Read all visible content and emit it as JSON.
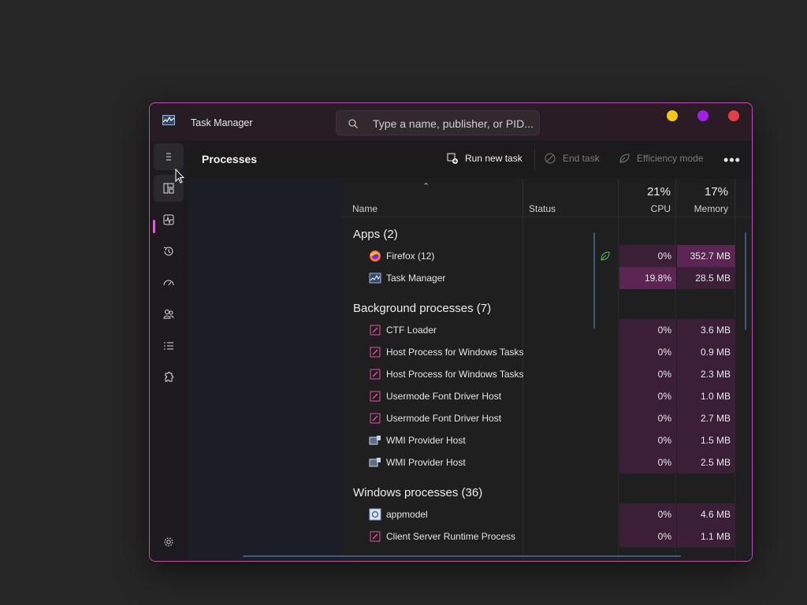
{
  "window": {
    "title": "Task Manager"
  },
  "search": {
    "placeholder": "Type a name, publisher, or PID..."
  },
  "toolbar": {
    "page_title": "Processes",
    "run_new_task": "Run new task",
    "end_task": "End task",
    "efficiency_mode": "Efficiency mode",
    "more": "•••"
  },
  "columns": {
    "name": "Name",
    "status": "Status",
    "cpu_pct": "21%",
    "cpu": "CPU",
    "memory_pct": "17%",
    "memory": "Memory"
  },
  "groups": {
    "apps": "Apps (2)",
    "background": "Background processes (7)",
    "windows": "Windows processes (36)"
  },
  "apps": [
    {
      "name": "Firefox (12)",
      "icon": "firefox-icon",
      "cpu": "0%",
      "memory": "352.7 MB",
      "efficiency": true
    },
    {
      "name": "Task Manager",
      "icon": "task-manager-icon",
      "cpu": "19.8%",
      "memory": "28.5 MB"
    }
  ],
  "background": [
    {
      "name": "CTF Loader",
      "icon": "edit-icon",
      "cpu": "0%",
      "memory": "3.6 MB"
    },
    {
      "name": "Host Process for Windows Tasks",
      "icon": "edit-icon",
      "cpu": "0%",
      "memory": "0.9 MB"
    },
    {
      "name": "Host Process for Windows Tasks",
      "icon": "edit-icon",
      "cpu": "0%",
      "memory": "2.3 MB"
    },
    {
      "name": "Usermode Font Driver Host",
      "icon": "edit-icon",
      "cpu": "0%",
      "memory": "1.0 MB"
    },
    {
      "name": "Usermode Font Driver Host",
      "icon": "edit-icon",
      "cpu": "0%",
      "memory": "2.7 MB"
    },
    {
      "name": "WMI Provider Host",
      "icon": "wmi-icon",
      "cpu": "0%",
      "memory": "1.5 MB"
    },
    {
      "name": "WMI Provider Host",
      "icon": "wmi-icon",
      "cpu": "0%",
      "memory": "2.5 MB"
    }
  ],
  "windows": [
    {
      "name": "appmodel",
      "icon": "gear-process-icon",
      "cpu": "0%",
      "memory": "4.6 MB"
    },
    {
      "name": "Client Server Runtime Process",
      "icon": "edit-icon",
      "cpu": "0%",
      "memory": "1.1 MB"
    }
  ],
  "colors": {
    "accent": "#e060c8",
    "border": "#c24fb0",
    "heat_low": "#3a1f37",
    "heat_high": "#5b2653"
  }
}
